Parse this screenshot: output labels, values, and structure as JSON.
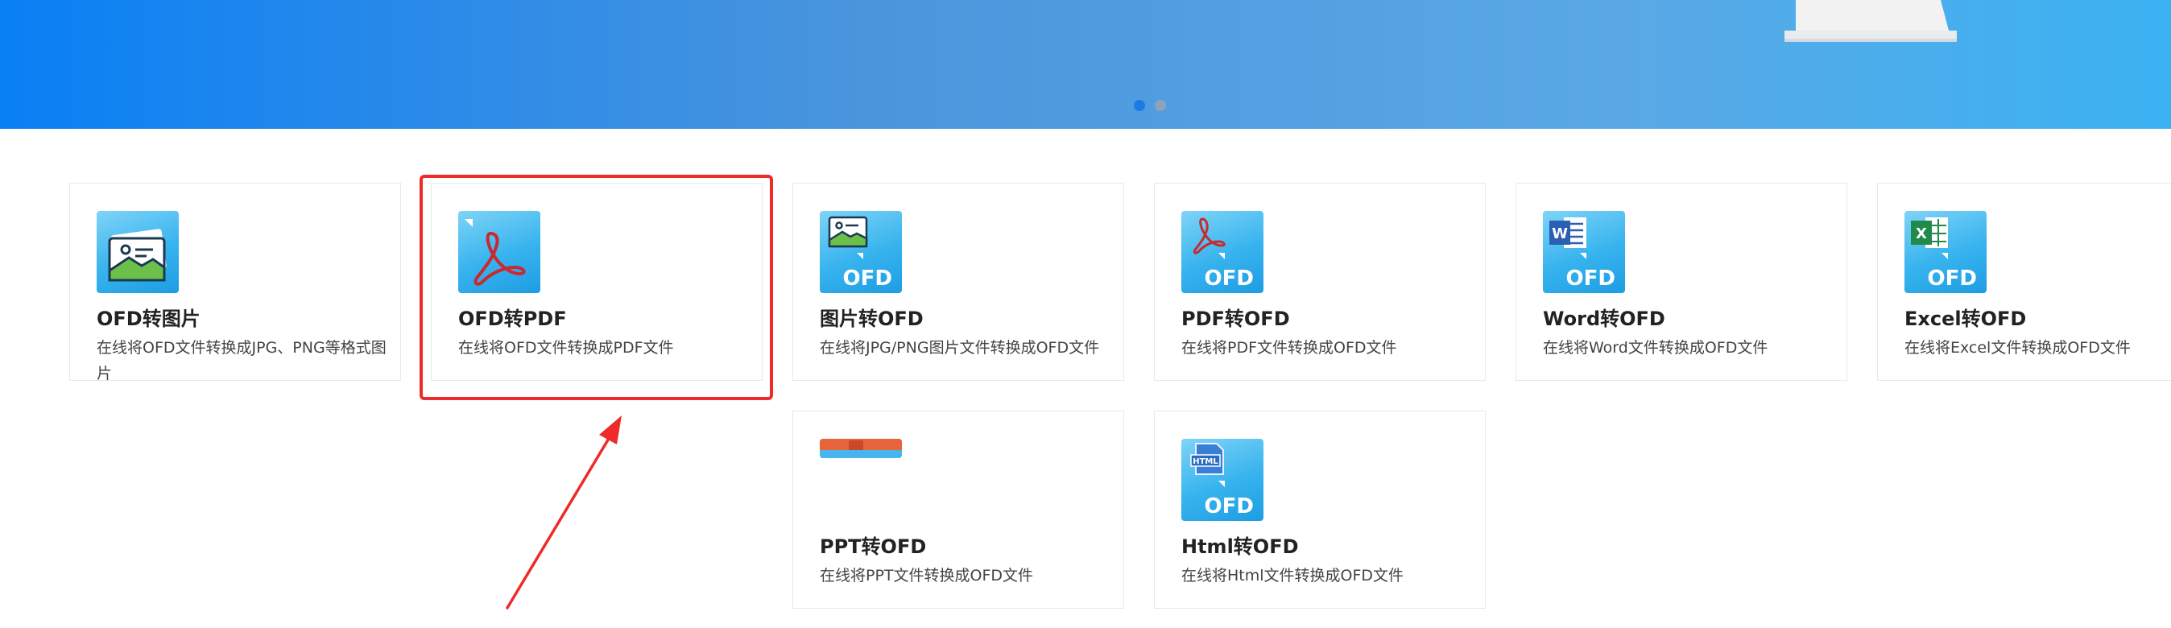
{
  "banner": {
    "slides": 2,
    "active_slide": 1
  },
  "accent_color": "#ee2a2a",
  "tools": [
    {
      "id": "ofd-to-image",
      "title": "OFD转图片",
      "desc": "在线将OFD文件转换成JPG、PNG等格式图片",
      "icon": "picture-icon"
    },
    {
      "id": "ofd-to-pdf",
      "title": "OFD转PDF",
      "desc": "在线将OFD文件转换成PDF文件",
      "icon": "pdf-icon"
    },
    {
      "id": "image-to-ofd",
      "title": "图片转OFD",
      "desc": "在线将JPG/PNG图片文件转换成OFD文件",
      "icon": "picture-ofd-icon",
      "badge": "OFD"
    },
    {
      "id": "pdf-to-ofd",
      "title": "PDF转OFD",
      "desc": "在线将PDF文件转换成OFD文件",
      "icon": "pdf-ofd-icon",
      "badge": "OFD"
    },
    {
      "id": "word-to-ofd",
      "title": "Word转OFD",
      "desc": "在线将Word文件转换成OFD文件",
      "icon": "word-ofd-icon",
      "badge": "OFD",
      "glyph": "W"
    },
    {
      "id": "excel-to-ofd",
      "title": "Excel转OFD",
      "desc": "在线将Excel文件转换成OFD文件",
      "icon": "excel-ofd-icon",
      "badge": "OFD",
      "glyph": "X"
    },
    {
      "id": "ppt-to-ofd",
      "title": "PPT转OFD",
      "desc": "在线将PPT文件转换成OFD文件",
      "icon": "ppt-ofd-icon"
    },
    {
      "id": "html-to-ofd",
      "title": "Html转OFD",
      "desc": "在线将Html文件转换成OFD文件",
      "icon": "html-ofd-icon",
      "badge": "OFD",
      "glyph": "HTML"
    }
  ]
}
